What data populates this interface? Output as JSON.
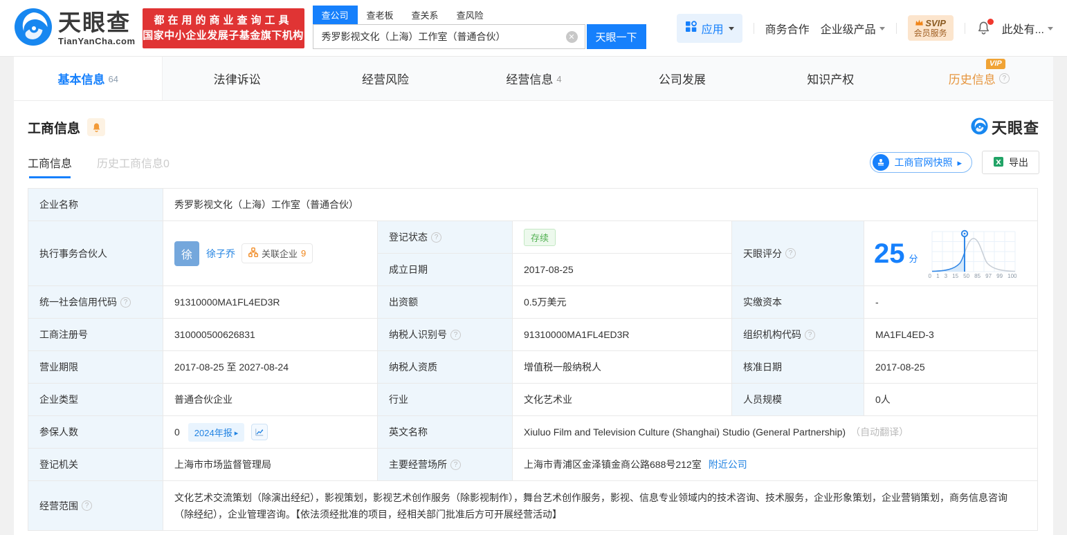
{
  "colors": {
    "accent_blue": "#1680fc",
    "link_blue": "#2283e2",
    "banner_red": "#e03434",
    "vip_orange": "#f0a335",
    "status_green": "#52b152",
    "label_cell_bg": "#eef6fc"
  },
  "header": {
    "logo": {
      "title": "天眼查",
      "domain": "TianYanCha.com"
    },
    "promo": {
      "line1": "都在用的商业查询工具",
      "line2": "国家中小企业发展子基金旗下机构"
    },
    "search": {
      "tabs": [
        "查公司",
        "查老板",
        "查关系",
        "查风险"
      ],
      "active_tab": "查公司",
      "value": "秀罗影视文化（上海）工作室（普通合伙）",
      "button": "天眼一下"
    },
    "actions": {
      "apps": "应用",
      "cooperation": "商务合作",
      "enterprise": "企业级产品",
      "svip_line1": "SVIP",
      "svip_line2": "会员服务",
      "user": "此处有..."
    }
  },
  "nav": {
    "tabs": [
      {
        "label": "基本信息",
        "count": "64"
      },
      {
        "label": "法律诉讼"
      },
      {
        "label": "经营风险"
      },
      {
        "label": "经营信息",
        "count": "4"
      },
      {
        "label": "公司发展"
      },
      {
        "label": "知识产权"
      },
      {
        "label": "历史信息",
        "vip": "VIP"
      }
    ]
  },
  "section": {
    "title": "工商信息",
    "subtab_active": "工商信息",
    "subtab_history": "历史工商信息0",
    "snapshot_button": "工商官网快照",
    "export_button": "导出",
    "watermark": "天眼查"
  },
  "table": {
    "company_name_label": "企业名称",
    "company_name": "秀罗影视文化（上海）工作室（普通合伙）",
    "partner_label": "执行事务合伙人",
    "partner_avatar": "徐",
    "partner_name": "徐子乔",
    "related_companies_label": "关联企业",
    "related_companies_count": "9",
    "reg_status_label": "登记状态",
    "reg_status": "存续",
    "est_date_label": "成立日期",
    "est_date": "2017-08-25",
    "score_label": "天眼评分",
    "score_value": "25",
    "score_unit": "分",
    "score_ticks": [
      "0",
      "1",
      "3",
      "15",
      "50",
      "85",
      "97",
      "99",
      "100"
    ],
    "credit_code_label": "统一社会信用代码",
    "credit_code": "91310000MA1FL4ED3R",
    "capital_label": "出资额",
    "capital": "0.5万美元",
    "paid_capital_label": "实缴资本",
    "paid_capital": "-",
    "reg_number_label": "工商注册号",
    "reg_number": "310000500626831",
    "taxpayer_id_label": "纳税人识别号",
    "taxpayer_id": "91310000MA1FL4ED3R",
    "org_code_label": "组织机构代码",
    "org_code": "MA1FL4ED-3",
    "business_term_label": "营业期限",
    "business_term": "2017-08-25 至 2027-08-24",
    "taxpayer_quality_label": "纳税人资质",
    "taxpayer_quality": "增值税一般纳税人",
    "approval_date_label": "核准日期",
    "approval_date": "2017-08-25",
    "company_type_label": "企业类型",
    "company_type": "普通合伙企业",
    "industry_label": "行业",
    "industry": "文化艺术业",
    "staff_size_label": "人员规模",
    "staff_size": "0人",
    "insured_label": "参保人数",
    "insured": "0",
    "annual_report_badge": "2024年报",
    "english_name_label": "英文名称",
    "english_name": "Xiuluo Film and Television Culture (Shanghai) Studio (General Partnership)",
    "english_name_note": "（自动翻译）",
    "reg_authority_label": "登记机关",
    "reg_authority": "上海市市场监督管理局",
    "business_site_label": "主要经营场所",
    "business_site": "上海市青浦区金泽镇金商公路688号212室",
    "nearby_link": "附近公司",
    "business_scope_label": "经营范围",
    "business_scope": "文化艺术交流策划（除演出经纪），影视策划，影视艺术创作服务（除影视制作），舞台艺术创作服务，影视、信息专业领域内的技术咨询、技术服务，企业形象策划，企业营销策划，商务信息咨询（除经纪），企业管理咨询。【依法须经批准的项目，经相关部门批准后方可开展经营活动】"
  }
}
